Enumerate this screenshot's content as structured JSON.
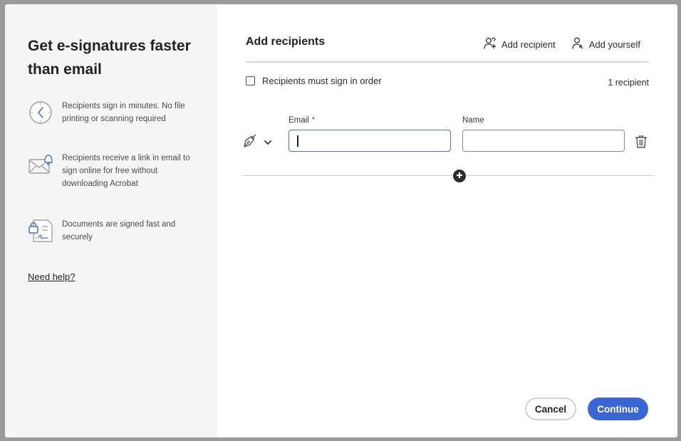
{
  "left_panel": {
    "title": "Get e-signatures faster than email",
    "features": [
      {
        "icon": "clock-icon",
        "text": "Recipients sign in minutes. No file printing or scanning required"
      },
      {
        "icon": "envelope-bell-icon",
        "text": "Recipients receive a link in email to sign online for free without downloading Acrobat"
      },
      {
        "icon": "secure-document-icon",
        "text": "Documents are signed fast and securely"
      }
    ],
    "help_link": "Need help?"
  },
  "main": {
    "title": "Add recipients",
    "actions": {
      "add_recipient": "Add recipient",
      "add_yourself": "Add yourself"
    },
    "sign_in_order": {
      "label": "Recipients must sign in order",
      "checked": false
    },
    "recipient_count": "1 recipient",
    "recipients": [
      {
        "role_icon": "pen-nib-icon",
        "email_label": "Email",
        "email_required_mark": "*",
        "email_value": "",
        "name_label": "Name",
        "name_value": ""
      }
    ]
  },
  "footer": {
    "cancel": "Cancel",
    "continue": "Continue"
  },
  "colors": {
    "primary": "#3a66d4",
    "focus_border": "#4a72c8",
    "icon_accent": "#4a72c8",
    "left_panel_bg": "#f5f5f5",
    "backdrop": "#9a9a9a"
  }
}
